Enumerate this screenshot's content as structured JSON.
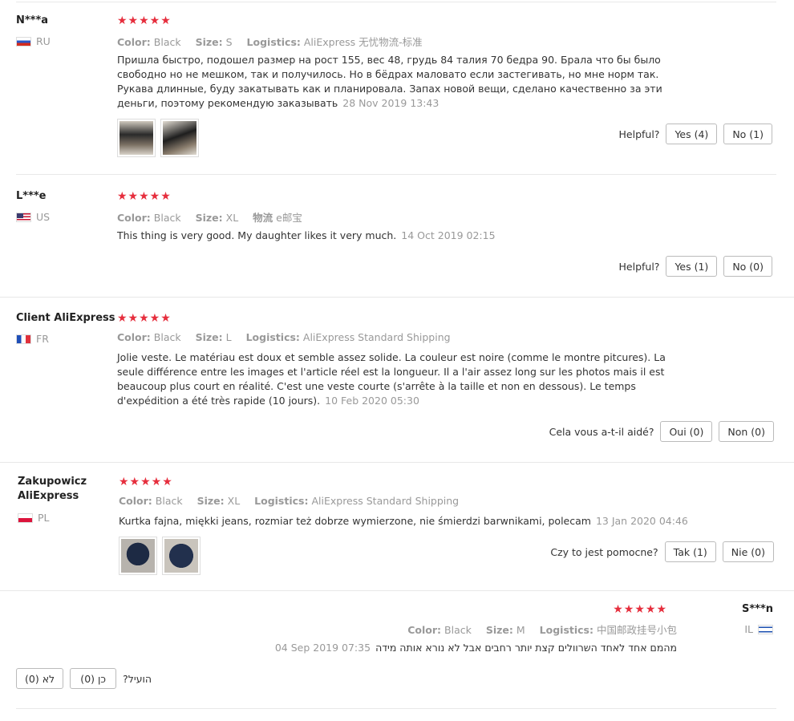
{
  "colors": {
    "star": "#e62e3d",
    "muted": "#999999",
    "text": "#333333"
  },
  "reviews": [
    {
      "user": "N***a",
      "country": "RU",
      "flag": "ru-flag",
      "rating": 5,
      "color_label": "Color:",
      "color": "Black",
      "size_label": "Size:",
      "size": "S",
      "ship_label": "Logistics:",
      "ship": "AliExpress 无忧物流-标准",
      "text": "Пришла быстро, подошел размер на рост 155, вес 48, грудь 84 талия 70 бедра 90. Брала что бы было свободно но не мешком, так и получилось. Но в бёдрах маловато если застегивать, но мне норм так. Рукава длинные, буду закатывать как и планировала. Запах новой вещи, сделано качественно за эти деньги, поэтому рекомендую заказывать",
      "date": "28 Nov 2019 13:43",
      "helpful_label": "Helpful?",
      "yes": "Yes (4)",
      "no": "No (1)"
    },
    {
      "user": "L***e",
      "country": "US",
      "flag": "us-flag",
      "rating": 5,
      "color_label": "Color:",
      "color": "Black",
      "size_label": "Size:",
      "size": "XL",
      "ship_label": "物流",
      "ship": "e邮宝",
      "text": "This thing is very good. My daughter likes it very much.",
      "date": "14 Oct 2019 02:15",
      "helpful_label": "Helpful?",
      "yes": "Yes (1)",
      "no": "No (0)"
    },
    {
      "user": "Client AliExpress",
      "country": "FR",
      "flag": "fr-flag",
      "rating": 5,
      "color_label": "Color:",
      "color": "Black",
      "size_label": "Size:",
      "size": "L",
      "ship_label": "Logistics:",
      "ship": "AliExpress Standard Shipping",
      "text": "Jolie veste. Le matériau est doux et semble assez solide. La couleur est noire (comme le montre pitcures). La seule différence entre les images et l'article réel est la longueur. Il a l'air assez long sur les photos mais il est beaucoup plus court en réalité. C'est une veste courte (s'arrête à la taille et non en dessous). Le temps d'expédition a été très rapide (10 jours).",
      "date": "10 Feb 2020 05:30",
      "helpful_label": "Cela vous a-t-il aidé?",
      "yes": "Oui (0)",
      "no": "Non (0)"
    },
    {
      "user": "Zakupowicz AliExpress",
      "country": "PL",
      "flag": "pl-flag",
      "rating": 5,
      "color_label": "Color:",
      "color": "Black",
      "size_label": "Size:",
      "size": "XL",
      "ship_label": "Logistics:",
      "ship": "AliExpress Standard Shipping",
      "text": "Kurtka fajna, miękki jeans, rozmiar też dobrze wymierzone, nie śmierdzi barwnikami, polecam",
      "date": "13 Jan 2020 04:46",
      "helpful_label": "Czy to jest pomocne?",
      "yes": "Tak (1)",
      "no": "Nie (0)"
    },
    {
      "user": "S***n",
      "country": "IL",
      "flag": "il-flag",
      "rating": 5,
      "color_label": "Color:",
      "color": "Black",
      "size_label": "Size:",
      "size": "M",
      "ship_label": "Logistics:",
      "ship": "中国邮政挂号小包",
      "text": "מהמם אחד לאחד השרוולים קצת יותר רחבים אבל לא נורא אותה מידה",
      "date": "04 Sep 2019 07:35",
      "helpful_label": "הועיל?",
      "yes": "כן (0)",
      "no": "לא (0)"
    }
  ]
}
